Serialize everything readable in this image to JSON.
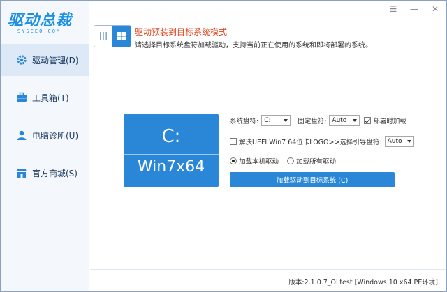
{
  "app": {
    "logo_main": "驱动总裁",
    "logo_sub": "SYSCEO.COM"
  },
  "window_controls": {
    "menu": "☰",
    "minimize": "—",
    "close": "✕"
  },
  "sidebar": {
    "items": [
      {
        "label": "驱动管理(D)",
        "icon": "gear-icon",
        "active": true
      },
      {
        "label": "工具箱(T)",
        "icon": "toolbox-icon",
        "active": false
      },
      {
        "label": "电脑诊所(U)",
        "icon": "user-icon",
        "active": false
      },
      {
        "label": "官方商城(S)",
        "icon": "store-icon",
        "active": false
      }
    ]
  },
  "header": {
    "mode_title": "驱动预装到目标系统模式",
    "mode_desc": "请选择目标系统盘符加载驱动，支持当前正在使用的系统和即将部署的系统。"
  },
  "drive": {
    "letter": "C:",
    "os": "Win7x64"
  },
  "options": {
    "sys_drive_label": "系统盘符:",
    "sys_drive_value": "C:",
    "fixed_drive_label": "固定盘符:",
    "fixed_drive_value": "Auto",
    "deploy_load_label": "部署时加载",
    "uefi_label": "解决UEFI Win7 64位卡LOGO>>选择引导盘符:",
    "uefi_value": "Auto",
    "radio_local": "加载本机驱动",
    "radio_all": "加载所有驱动",
    "load_button": "加载驱动到目标系统 (C)"
  },
  "footer": {
    "version": "版本:2.1.0.7_OLtest [Windows 10 x64 PE环境]"
  },
  "colors": {
    "accent": "#2a86d6",
    "title_red": "#e0451d",
    "sidebar_bg": "#f4f8fc"
  }
}
